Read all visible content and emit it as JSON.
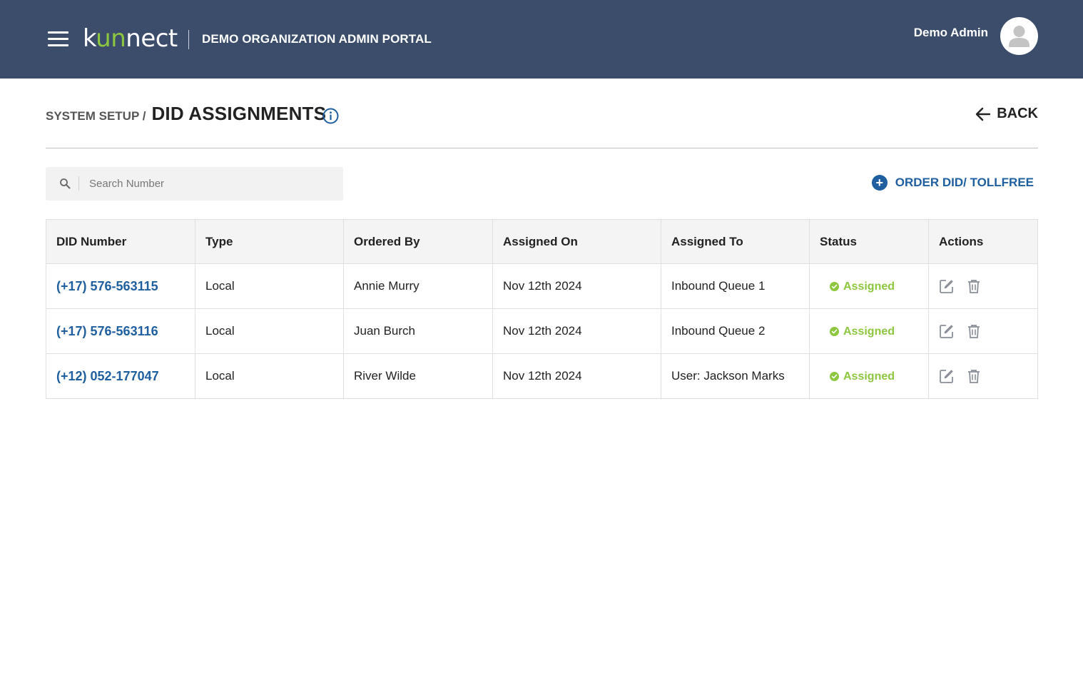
{
  "header": {
    "logo_text_pre": "k",
    "logo_text_accent": "un",
    "logo_text_post": "nect",
    "portal_title": "DEMO ORGANIZATION ADMIN PORTAL",
    "user_name": "Demo Admin",
    "background_color": "#3b4d6b",
    "accent_color": "#8dc63f"
  },
  "breadcrumb": {
    "parent": "SYSTEM SETUP /",
    "current": "DID ASSIGNMENTS"
  },
  "back_label": "BACK",
  "search": {
    "placeholder": "Search Number",
    "value": ""
  },
  "order_button_label": "ORDER DID/ TOLLFREE",
  "table": {
    "columns": [
      "DID Number",
      "Type",
      "Ordered By",
      "Assigned On",
      "Assigned To",
      "Status",
      "Actions"
    ],
    "rows": [
      {
        "did": "(+17) 576-563115",
        "type": "Local",
        "ordered_by": "Annie Murry",
        "assigned_on": "Nov 12th 2024",
        "assigned_to": "Inbound Queue 1",
        "status": "Assigned"
      },
      {
        "did": "(+17) 576-563116",
        "type": "Local",
        "ordered_by": "Juan Burch",
        "assigned_on": "Nov 12th 2024",
        "assigned_to": "Inbound Queue 2",
        "status": "Assigned"
      },
      {
        "did": "(+12) 052-177047",
        "type": "Local",
        "ordered_by": "River Wilde",
        "assigned_on": "Nov 12th 2024",
        "assigned_to": "User: Jackson Marks",
        "status": "Assigned"
      }
    ]
  },
  "colors": {
    "link_blue": "#1f5fa0",
    "status_green": "#8dc63f",
    "icon_gray": "#8a8f98"
  },
  "icons": [
    "hamburger-menu-icon",
    "user-avatar-icon",
    "info-icon",
    "arrow-left-icon",
    "search-icon",
    "plus-circle-icon",
    "check-circle-icon",
    "edit-icon",
    "trash-icon"
  ]
}
